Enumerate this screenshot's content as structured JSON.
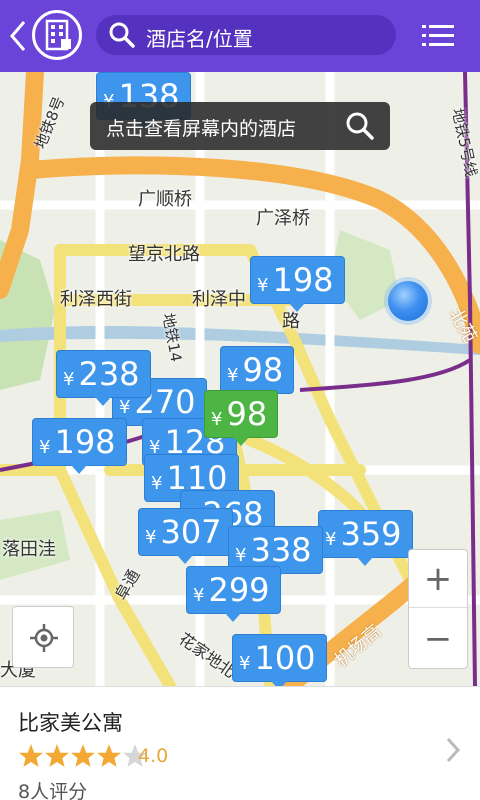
{
  "topbar": {
    "search_placeholder": "酒店名/位置"
  },
  "map": {
    "toast": "点击查看屏幕内的酒店",
    "road_labels": [
      {
        "text": "广顺桥"
      },
      {
        "text": "广泽桥"
      },
      {
        "text": "望京北路"
      },
      {
        "text": "利泽西街"
      },
      {
        "text": "利泽中"
      },
      {
        "text": "路"
      },
      {
        "text": "落田洼"
      },
      {
        "text": "大厦"
      },
      {
        "text": "地铁8号"
      },
      {
        "text": "地铁5号线"
      },
      {
        "text": "地铁14"
      },
      {
        "text": "花家地北"
      },
      {
        "text": "阜通"
      },
      {
        "text": "机场高"
      },
      {
        "text": "北苑"
      }
    ],
    "markers": [
      {
        "currency": "¥",
        "price": "138"
      },
      {
        "currency": "¥",
        "price": "198"
      },
      {
        "currency": "¥",
        "price": "238"
      },
      {
        "currency": "¥",
        "price": "98"
      },
      {
        "currency": "¥",
        "price": "270"
      },
      {
        "currency": "¥",
        "price": "198"
      },
      {
        "currency": "¥",
        "price": "128"
      },
      {
        "currency": "¥",
        "price": "98",
        "selected": true
      },
      {
        "currency": "¥",
        "price": "110"
      },
      {
        "currency": "¥",
        "price": "268"
      },
      {
        "currency": "¥",
        "price": "307"
      },
      {
        "currency": "¥",
        "price": "359"
      },
      {
        "currency": "¥",
        "price": "338"
      },
      {
        "currency": "¥",
        "price": "299"
      },
      {
        "currency": "¥",
        "price": "100"
      }
    ],
    "zoom_in": "+",
    "zoom_out": "−"
  },
  "hotel": {
    "name": "比家美公寓",
    "stars": 4,
    "rating": "4.0",
    "reviews": "8人评分"
  },
  "colors": {
    "brand": "#6a43d8",
    "marker": "#3e96ec",
    "marker_selected": "#4cb544",
    "star": "#f2a833"
  }
}
